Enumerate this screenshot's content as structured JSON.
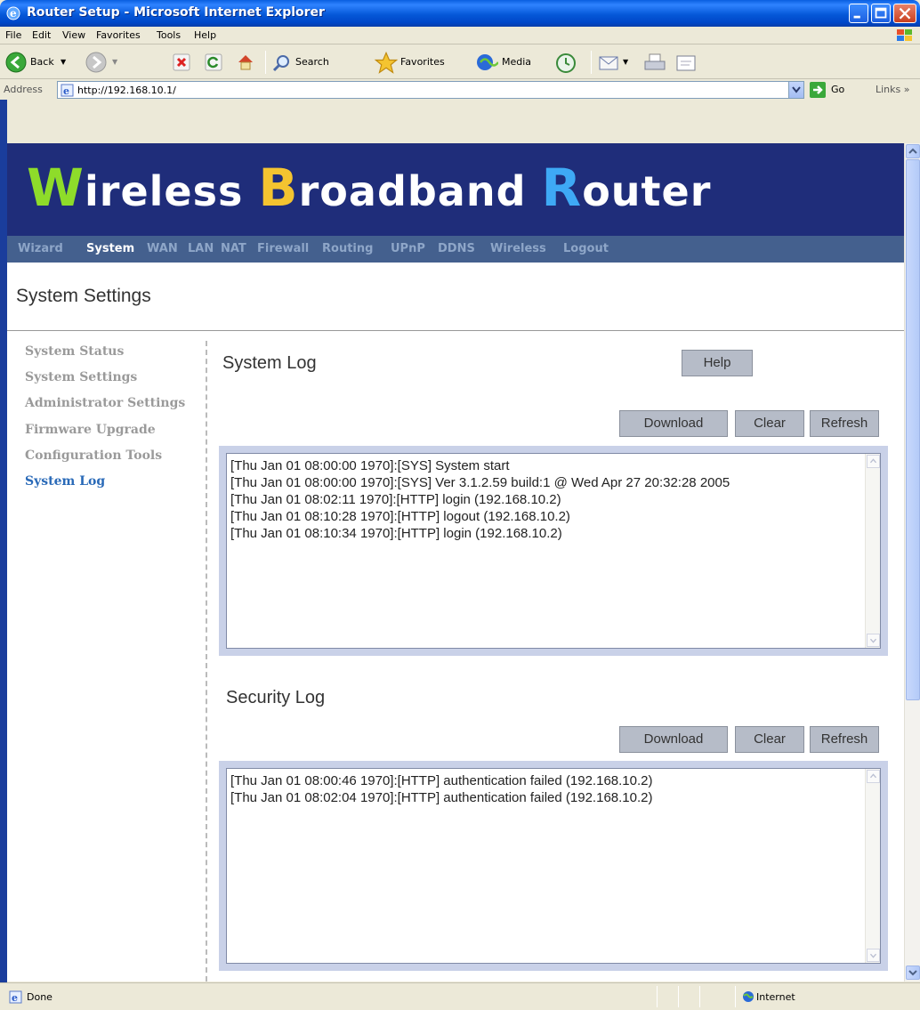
{
  "window": {
    "title": "Router Setup - Microsoft Internet Explorer"
  },
  "menubar": {
    "items": [
      "File",
      "Edit",
      "View",
      "Favorites",
      "Tools",
      "Help"
    ]
  },
  "toolbar": {
    "back_label": "Back",
    "search_label": "Search",
    "favorites_label": "Favorites",
    "media_label": "Media"
  },
  "addressbar": {
    "label": "Address",
    "url": "http://192.168.10.1/",
    "go_label": "Go",
    "links_label": "Links"
  },
  "page": {
    "banner": {
      "word1_cap": "W",
      "word1_rest": "ireless",
      "word2_cap": "B",
      "word2_rest": "roadband",
      "word3_cap": "R",
      "word3_rest": "outer"
    },
    "nav": {
      "items": [
        "Wizard",
        "System",
        "WAN",
        "LAN",
        "NAT",
        "Firewall",
        "Routing",
        "UPnP",
        "DDNS",
        "Wireless",
        "Logout"
      ],
      "active": "System"
    },
    "page_title": "System Settings",
    "side_menu": {
      "items": [
        "System Status",
        "System Settings",
        "Administrator Settings",
        "Firmware Upgrade",
        "Configuration Tools",
        "System Log"
      ],
      "active": "System Log"
    },
    "help_label": "Help",
    "system_log": {
      "title": "System Log",
      "buttons": {
        "download": "Download",
        "clear": "Clear",
        "refresh": "Refresh"
      },
      "lines": [
        "[Thu Jan 01 08:00:00 1970]:[SYS] System start",
        "[Thu Jan 01 08:00:00 1970]:[SYS] Ver 3.1.2.59 build:1 @ Wed Apr 27 20:32:28 2005",
        "[Thu Jan 01 08:02:11 1970]:[HTTP] login (192.168.10.2)",
        "[Thu Jan 01 08:10:28 1970]:[HTTP] logout (192.168.10.2)",
        "[Thu Jan 01 08:10:34 1970]:[HTTP] login (192.168.10.2)"
      ]
    },
    "security_log": {
      "title": "Security Log",
      "buttons": {
        "download": "Download",
        "clear": "Clear",
        "refresh": "Refresh"
      },
      "lines": [
        "[Thu Jan 01 08:00:46 1970]:[HTTP] authentication failed (192.168.10.2)",
        "[Thu Jan 01 08:02:04 1970]:[HTTP] authentication failed (192.168.10.2)"
      ]
    }
  },
  "statusbar": {
    "status": "Done",
    "zone": "Internet"
  },
  "colors": {
    "banner_bg": "#1f2d7a",
    "cap_w": "#8edc2a",
    "cap_b": "#f4c430",
    "cap_r": "#3ea9f5",
    "nav_bg": "#44608e",
    "side_active": "#2a6ab8"
  }
}
